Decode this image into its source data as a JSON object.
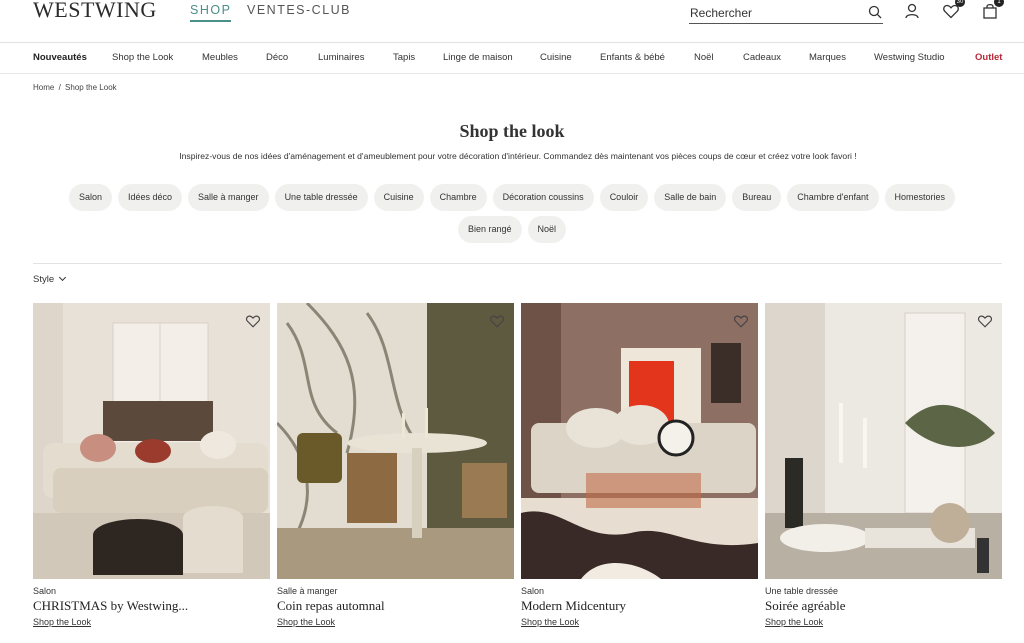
{
  "header": {
    "logo": "WESTWING",
    "tabs": [
      "SHOP",
      "VENTES-CLUB"
    ],
    "search_placeholder": "Rechercher",
    "wishlist_count": "30",
    "cart_count": "1"
  },
  "nav": [
    "Nouveautés",
    "Shop the Look",
    "Meubles",
    "Déco",
    "Luminaires",
    "Tapis",
    "Linge de maison",
    "Cuisine",
    "Enfants & bébé",
    "Noël",
    "Cadeaux",
    "Marques",
    "Westwing Studio",
    "Outlet"
  ],
  "breadcrumb": [
    "Home",
    "/",
    "Shop the Look"
  ],
  "page": {
    "title": "Shop the look",
    "subtitle": "Inspirez-vous de nos idées d'aménagement et d'ameublement pour votre décoration d'intérieur. Commandez dès maintenant vos pièces coups de cœur et créez votre look favori !"
  },
  "chips": [
    "Salon",
    "Idées déco",
    "Salle à manger",
    "Une table dressée",
    "Cuisine",
    "Chambre",
    "Décoration coussins",
    "Couloir",
    "Salle de bain",
    "Bureau",
    "Chambre d'enfant",
    "Homestories",
    "Bien rangé",
    "Noël"
  ],
  "filter": {
    "label": "Style"
  },
  "cards": [
    {
      "category": "Salon",
      "title": "CHRISTMAS by Westwing...",
      "link": "Shop the Look"
    },
    {
      "category": "Salle à manger",
      "title": "Coin repas automnal",
      "link": "Shop the Look"
    },
    {
      "category": "Salon",
      "title": "Modern Midcentury",
      "link": "Shop the Look"
    },
    {
      "category": "Une table dressée",
      "title": "Soirée agréable",
      "link": "Shop the Look"
    }
  ],
  "colors": {
    "accent": "#4a8f8a",
    "outlet": "#b8283a",
    "chip_bg": "#f0f0ee"
  }
}
